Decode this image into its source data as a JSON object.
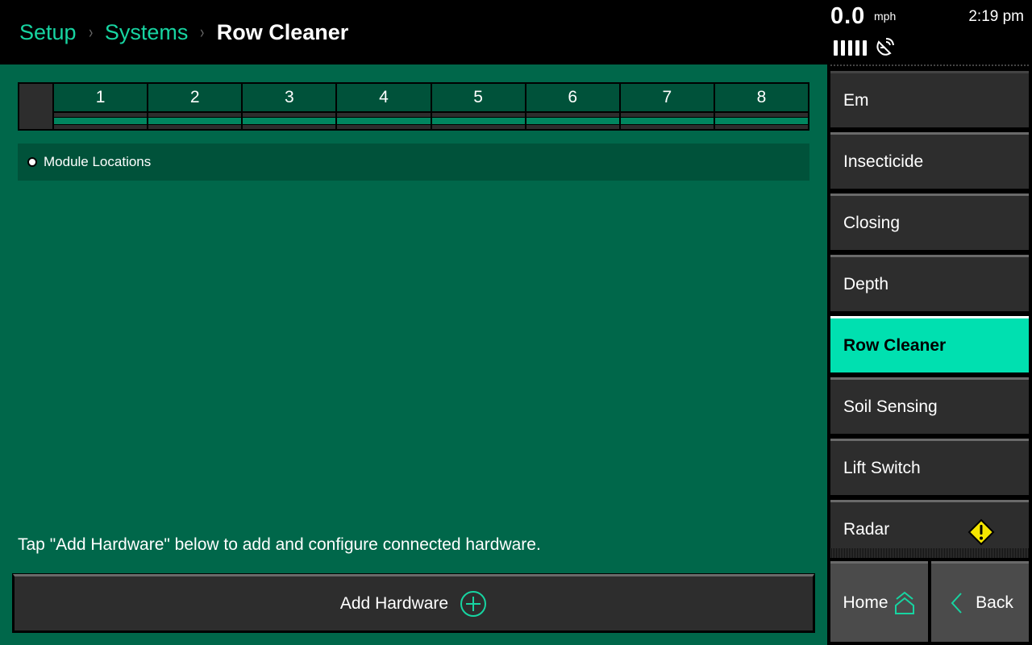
{
  "header": {
    "breadcrumb": [
      {
        "label": "Setup"
      },
      {
        "label": "Systems"
      }
    ],
    "separator": "›",
    "current": "Row Cleaner"
  },
  "status": {
    "speed": "0.0",
    "speed_unit": "mph",
    "time": "2:19 pm",
    "signal_bars": 5,
    "satellite_icon": "satellite-dish-icon"
  },
  "main": {
    "row_grid": {
      "rows": [
        "1",
        "2",
        "3",
        "4",
        "5",
        "6",
        "7",
        "8"
      ]
    },
    "legend": {
      "label": "Module Locations"
    },
    "hint": "Tap \"Add Hardware\" below to add and configure connected hardware.",
    "add_button": {
      "label": "Add Hardware",
      "icon": "plus-circle-icon"
    }
  },
  "sidebar": {
    "items": [
      {
        "label": "Em"
      },
      {
        "label": "Insecticide"
      },
      {
        "label": "Closing"
      },
      {
        "label": "Depth"
      },
      {
        "label": "Row Cleaner",
        "active": true
      },
      {
        "label": "Soil Sensing"
      },
      {
        "label": "Lift Switch"
      },
      {
        "label": "Radar",
        "warning": true
      }
    ],
    "home_label": "Home",
    "back_label": "Back"
  },
  "colors": {
    "accent": "#17d4a1",
    "active_item": "#00e0b0",
    "main_bg": "#00674a",
    "panel_dark": "#00523a",
    "bar_fill": "#00865f",
    "warning": "#f5e600"
  }
}
